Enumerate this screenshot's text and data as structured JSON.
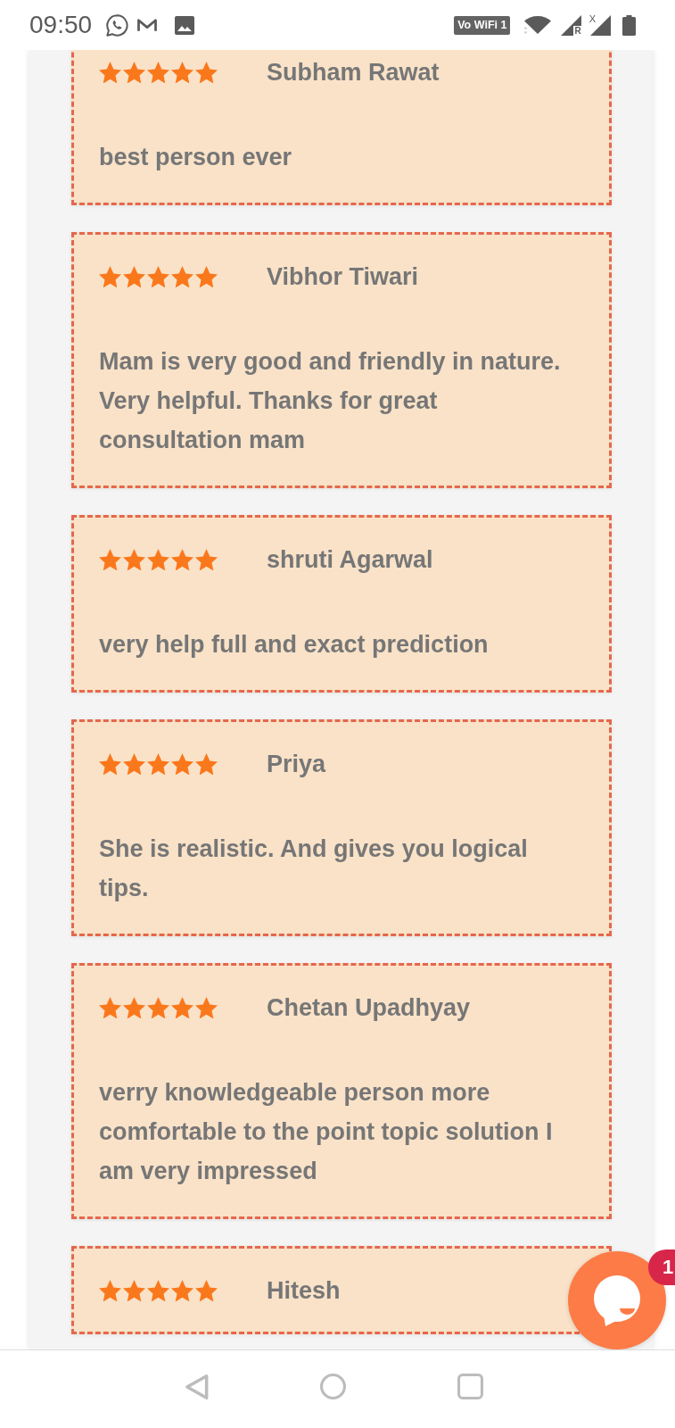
{
  "status_bar": {
    "time": "09:50",
    "network_badge": "Vo WiFi 1",
    "sim_1_mark": "R",
    "sim_2_mark": "X"
  },
  "reviews": [
    {
      "stars": 5,
      "name": "Subham Rawat",
      "text": "best person ever"
    },
    {
      "stars": 5,
      "name": "Vibhor Tiwari",
      "text": "Mam is very good and friendly in nature. Very helpful. Thanks for great consultation mam"
    },
    {
      "stars": 5,
      "name": "shruti Agarwal",
      "text": "very help full and exact prediction"
    },
    {
      "stars": 5,
      "name": "Priya",
      "text": "She is realistic. And gives you logical tips."
    },
    {
      "stars": 5,
      "name": "Chetan Upadhyay",
      "text": "verry knowledgeable person more comfortable to the point topic solution I am very impressed"
    },
    {
      "stars": 5,
      "name": "Hitesh"
    }
  ],
  "chat_widget": {
    "badge": "1"
  }
}
